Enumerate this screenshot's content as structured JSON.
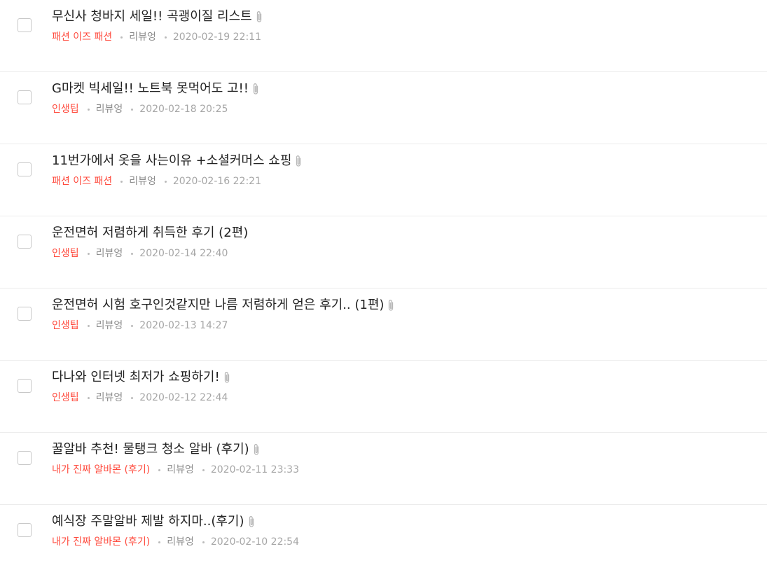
{
  "posts": [
    {
      "title": "무신사 청바지 세일!! 곡괭이질 리스트",
      "attachment": true,
      "category": "패션 이즈 패션",
      "author": "리뷰엉",
      "date": "2020-02-19 22:11"
    },
    {
      "title": "G마켓 빅세일!! 노트북 못먹어도 고!!",
      "attachment": true,
      "category": "인생팁",
      "author": "리뷰엉",
      "date": "2020-02-18 20:25"
    },
    {
      "title": "11번가에서 옷을 사는이유 +소셜커머스 쇼핑",
      "attachment": true,
      "category": "패션 이즈 패션",
      "author": "리뷰엉",
      "date": "2020-02-16 22:21"
    },
    {
      "title": "운전면허 저렴하게 취득한 후기 (2편)",
      "attachment": false,
      "category": "인생팁",
      "author": "리뷰엉",
      "date": "2020-02-14 22:40"
    },
    {
      "title": "운전면허 시험 호구인것같지만 나름 저렴하게 얻은 후기.. (1편)",
      "attachment": true,
      "category": "인생팁",
      "author": "리뷰엉",
      "date": "2020-02-13 14:27"
    },
    {
      "title": "다나와 인터넷 최저가 쇼핑하기!",
      "attachment": true,
      "category": "인생팁",
      "author": "리뷰엉",
      "date": "2020-02-12 22:44"
    },
    {
      "title": "꿀알바 추천! 물탱크 청소 알바 (후기)",
      "attachment": true,
      "category": "내가 진짜 알바몬 (후기)",
      "author": "리뷰엉",
      "date": "2020-02-11 23:33"
    },
    {
      "title": "예식장 주말알바 제발 하지마..(후기)",
      "attachment": true,
      "category": "내가 진짜 알바몬 (후기)",
      "author": "리뷰엉",
      "date": "2020-02-10 22:54"
    }
  ],
  "icons": {
    "attachment": "paperclip-icon"
  },
  "colors": {
    "category": "#ff4b3e",
    "title": "#222222",
    "meta": "#999999"
  }
}
